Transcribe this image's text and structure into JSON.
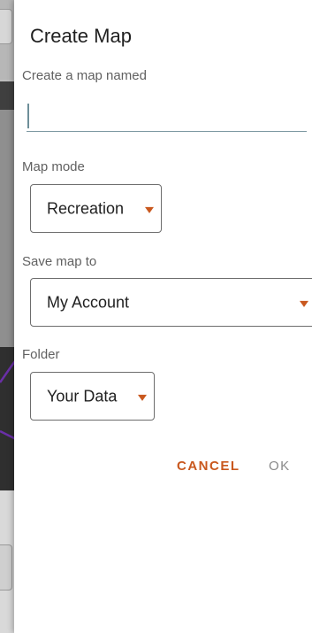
{
  "dialog": {
    "title": "Create Map",
    "name_label": "Create a map named",
    "name_value": "",
    "map_mode_label": "Map mode",
    "map_mode_value": "Recreation",
    "save_to_label": "Save map to",
    "save_to_value": "My Account",
    "folder_label": "Folder",
    "folder_value": "Your Data",
    "cancel_label": "CANCEL",
    "ok_label": "OK"
  },
  "colors": {
    "accent": "#c9581e",
    "disabled": "#8a8a8a",
    "underline": "#7f9aa3"
  }
}
